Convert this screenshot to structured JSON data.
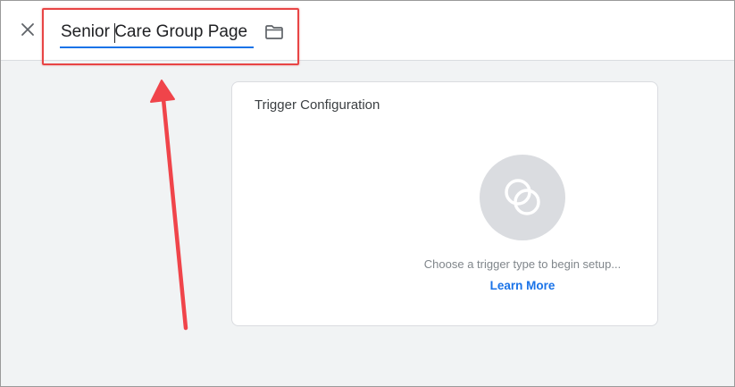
{
  "header": {
    "close_icon": "close-icon",
    "name_value": "Senior Care Group Page",
    "folder_icon": "folder-icon"
  },
  "card": {
    "title": "Trigger Configuration",
    "icon": "trigger-type-icon",
    "hint": "Choose a trigger type to begin setup...",
    "learn_more": "Learn More"
  },
  "colors": {
    "accent": "#1a73e8",
    "annotation": "#e84545",
    "background": "#f1f3f4",
    "icon_circle": "#dadce0"
  }
}
